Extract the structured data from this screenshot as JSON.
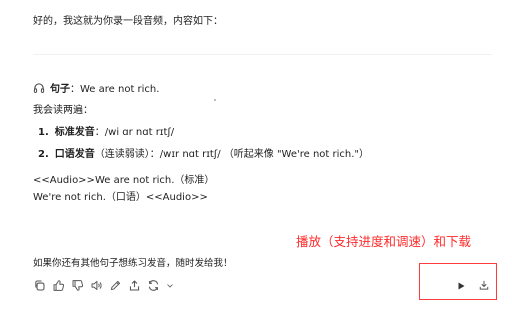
{
  "message": {
    "intro": "好的，我这就为你录一段音频，内容如下：",
    "sentence_label": "句子",
    "sentence_text": "：We are not rich.",
    "read_twice": "我会读两遍：",
    "items": [
      {
        "num": "1.",
        "label": "标准发音",
        "text": "：/wi ɑr nɑt rɪtʃ/",
        "note": ""
      },
      {
        "num": "2.",
        "label": "口语发音",
        "text": "（连读弱读）：/wɪr nɑt rɪtʃ/ （听起来像 \"We're not rich.\"）",
        "note": ""
      }
    ],
    "audio_line_1": "<<Audio>>We are not rich.（标准）",
    "audio_line_2": "We're not rich.（口语）<<Audio>>",
    "followup": "如果你还有其他句子想练习发音，随时发给我！"
  },
  "annotation": {
    "text": "播放（支持进度和调速）和下载",
    "color": "#ff2a2a"
  },
  "toolbar": {
    "icons": [
      "copy-icon",
      "thumbs-up-icon",
      "thumbs-down-icon",
      "speaker-icon",
      "edit-icon",
      "share-icon",
      "regenerate-icon",
      "chevron-down-icon"
    ]
  },
  "audio_controls": {
    "icons": [
      "play-icon",
      "download-icon"
    ]
  }
}
